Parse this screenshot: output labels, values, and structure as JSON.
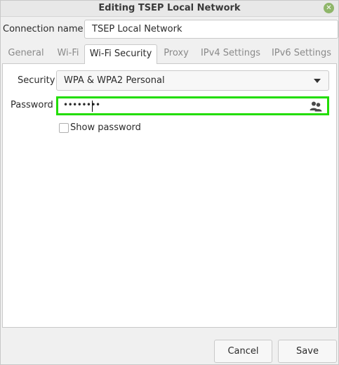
{
  "window": {
    "title": "Editing TSEP Local Network",
    "close_icon": "close-icon"
  },
  "connection": {
    "label": "Connection name",
    "value": "TSEP Local Network"
  },
  "tabs": [
    {
      "label": "General",
      "active": false
    },
    {
      "label": "Wi-Fi",
      "active": false
    },
    {
      "label": "Wi-Fi Security",
      "active": true
    },
    {
      "label": "Proxy",
      "active": false
    },
    {
      "label": "IPv4 Settings",
      "active": false
    },
    {
      "label": "IPv6 Settings",
      "active": false
    }
  ],
  "security": {
    "label": "Security",
    "selected": "WPA & WPA2 Personal"
  },
  "password": {
    "label": "Password",
    "masked_value": "••••••••",
    "icon": "users-icon",
    "focus_color": "#22dd00"
  },
  "show_password": {
    "label": "Show password",
    "checked": false
  },
  "buttons": {
    "cancel": "Cancel",
    "save": "Save"
  },
  "colors": {
    "accent_focus": "#22dd00",
    "close_button": "#8fb66a"
  }
}
